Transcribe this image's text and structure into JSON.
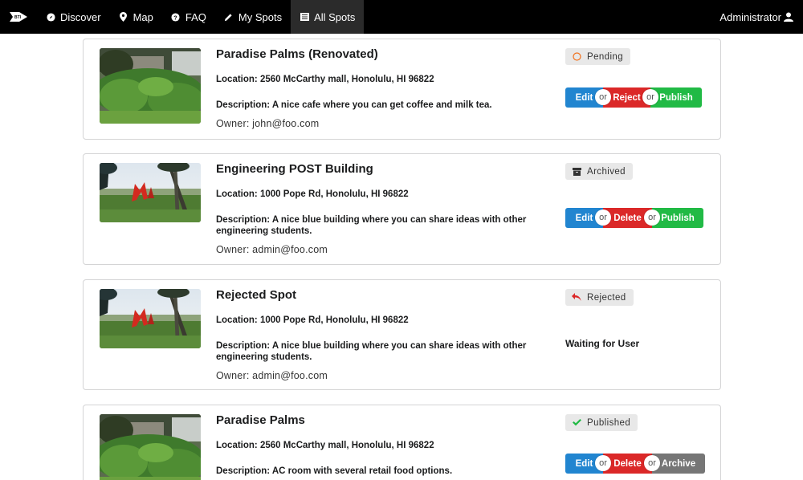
{
  "nav": {
    "items": [
      {
        "label": "Discover",
        "icon": "compass-icon"
      },
      {
        "label": "Map",
        "icon": "map-pin-icon"
      },
      {
        "label": "FAQ",
        "icon": "question-circle-icon"
      },
      {
        "label": "My Spots",
        "icon": "pencil-icon"
      },
      {
        "label": "All Spots",
        "icon": "list-icon"
      }
    ],
    "active": "All Spots",
    "user": "Administrator",
    "logo_icon": "bti-logo-icon"
  },
  "cards": [
    {
      "title": "Paradise Palms (Renovated)",
      "location": "Location: 2560 McCarthy mall, Honolulu, HI 96822",
      "description": "Description: A nice cafe where you can get coffee and milk tea.",
      "owner": "Owner: john@foo.com",
      "status": "Pending",
      "status_icon": "circle-outline-icon",
      "image": "garden-plants-image",
      "actions": [
        "Edit",
        "Reject",
        "Publish"
      ],
      "or_label": "or"
    },
    {
      "title": "Engineering POST Building",
      "location": "Location: 1000 Pope Rd, Honolulu, HI 96822",
      "description": "Description: A nice blue building where you can share ideas with other engineering students.",
      "owner": "Owner: admin@foo.com",
      "status": "Archived",
      "status_icon": "archive-box-icon",
      "image": "red-sculpture-lawn-image",
      "actions": [
        "Edit",
        "Delete",
        "Publish"
      ],
      "or_label": "or"
    },
    {
      "title": "Rejected Spot",
      "location": "Location: 1000 Pope Rd, Honolulu, HI 96822",
      "description": "Description: A nice blue building where you can share ideas with other engineering students.",
      "owner": "Owner: admin@foo.com",
      "status": "Rejected",
      "status_icon": "reply-arrow-icon",
      "image": "red-sculpture-lawn-image",
      "waiting": "Waiting for User"
    },
    {
      "title": "Paradise Palms",
      "location": "Location: 2560 McCarthy mall, Honolulu, HI 96822",
      "description": "Description: AC room with several retail food options.",
      "status": "Published",
      "status_icon": "checkmark-icon",
      "image": "garden-plants-image",
      "actions": [
        "Edit",
        "Delete",
        "Archive"
      ],
      "or_label": "or"
    }
  ],
  "colors": {
    "navbar": "#000000",
    "edit": "#2185d0",
    "reject_delete": "#db2828",
    "publish": "#21ba45",
    "archive": "#767676",
    "badge_bg": "#e8e8e8"
  }
}
